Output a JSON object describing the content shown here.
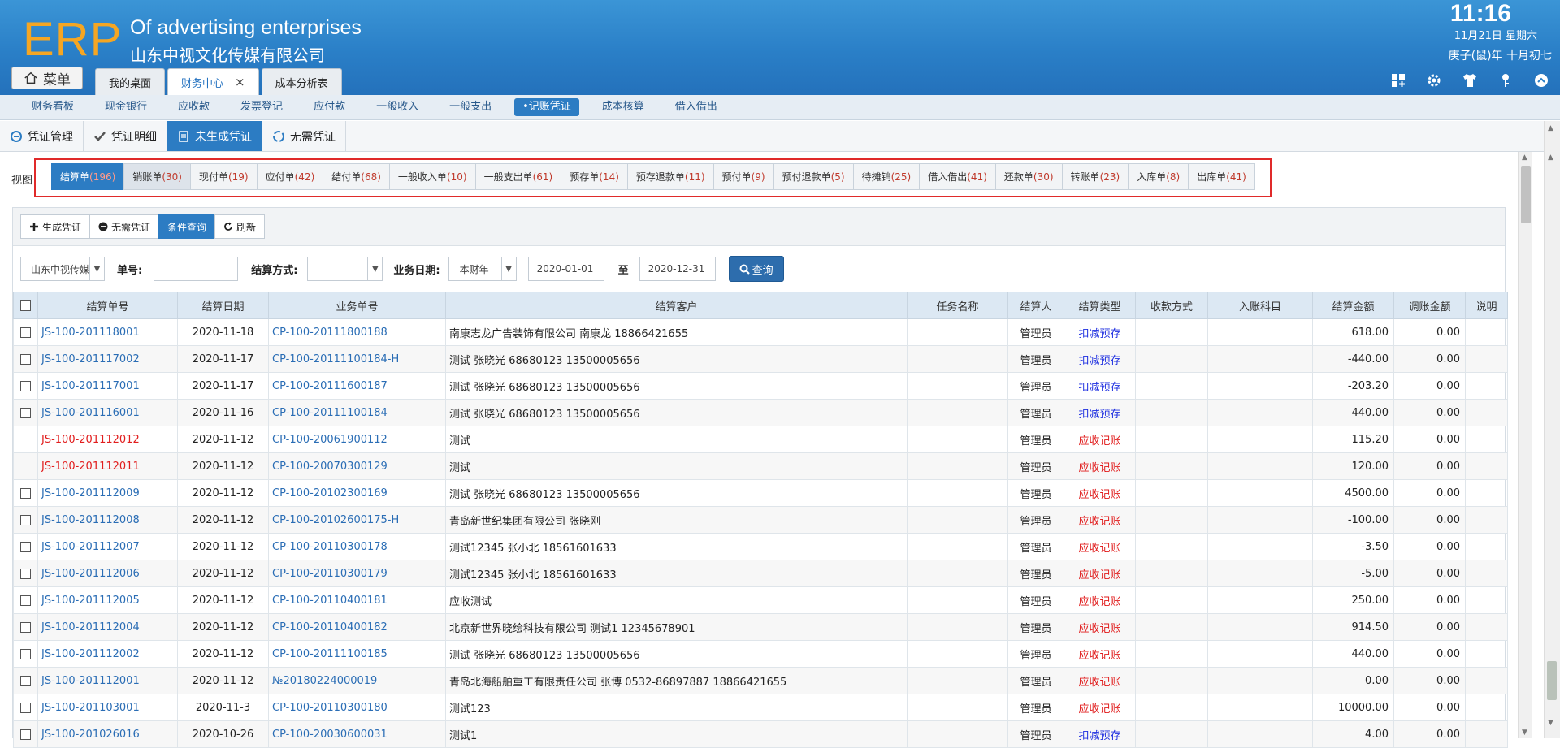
{
  "header": {
    "logo": "ERP",
    "enterprise_en": "Of advertising enterprises",
    "enterprise_cn": "山东中视文化传媒有限公司",
    "time": "11:16",
    "date": "11月21日 星期六",
    "lunar_date": "庚子(鼠)年 十月初七",
    "menu_label": "菜单",
    "tabs": [
      {
        "label": "我的桌面",
        "active": false
      },
      {
        "label": "财务中心",
        "active": true,
        "closable": true
      },
      {
        "label": "成本分析表",
        "active": false
      }
    ],
    "icons": [
      "grid-add-icon",
      "gear-icon",
      "shirt-icon",
      "key-icon",
      "chevron-up-circle-icon"
    ]
  },
  "modules": [
    "财务看板",
    "现金银行",
    "应收款",
    "发票登记",
    "应付款",
    "一般收入",
    "一般支出",
    "•记账凭证",
    "成本核算",
    "借入借出"
  ],
  "active_module": "•记账凭证",
  "sub_nav": [
    {
      "label": "凭证管理",
      "icon": "voucher-icon",
      "active": false
    },
    {
      "label": "凭证明细",
      "icon": "check-icon",
      "active": false
    },
    {
      "label": "未生成凭证",
      "icon": "document-icon",
      "active": true
    },
    {
      "label": "无需凭证",
      "icon": "recycle-icon",
      "active": false
    }
  ],
  "view_label": "视图",
  "view_tabs": [
    {
      "name": "结算单",
      "count": "(196)",
      "active": true
    },
    {
      "name": "销账单",
      "count": "(30)"
    },
    {
      "name": "现付单",
      "count": "(19)"
    },
    {
      "name": "应付单",
      "count": "(42)"
    },
    {
      "name": "结付单",
      "count": "(68)"
    },
    {
      "name": "一般收入单",
      "count": "(10)"
    },
    {
      "name": "一般支出单",
      "count": "(61)"
    },
    {
      "name": "预存单",
      "count": "(14)"
    },
    {
      "name": "预存退款单",
      "count": "(11)"
    },
    {
      "name": "预付单",
      "count": "(9)"
    },
    {
      "name": "预付退款单",
      "count": "(5)"
    },
    {
      "name": "待摊销",
      "count": "(25)"
    },
    {
      "name": "借入借出",
      "count": "(41)"
    },
    {
      "name": "还款单",
      "count": "(30)"
    },
    {
      "name": "转账单",
      "count": "(23)"
    },
    {
      "name": "入库单",
      "count": "(8)"
    },
    {
      "name": "出库单",
      "count": "(41)"
    }
  ],
  "toolbar": {
    "generate": "生成凭证",
    "no_need": "无需凭证",
    "condition_query": "条件查询",
    "refresh": "刷新"
  },
  "filter": {
    "company": "山东中视传媒",
    "doc_no_label": "单号:",
    "doc_no_value": "",
    "settle_method_label": "结算方式:",
    "settle_method_value": "",
    "biz_date_label": "业务日期:",
    "period": "本财年",
    "date_from": "2020-01-01",
    "to_label": "至",
    "date_to": "2020-12-31",
    "query": "查询"
  },
  "table": {
    "columns": [
      "结算单号",
      "结算日期",
      "业务单号",
      "结算客户",
      "任务名称",
      "结算人",
      "结算类型",
      "收款方式",
      "入账科目",
      "结算金额",
      "调账金额",
      "说明"
    ],
    "rows": [
      {
        "checkbox": true,
        "no": "JS-100-201118001",
        "red": false,
        "date": "2020-11-18",
        "biz": "CP-100-20111800188",
        "customer": "南康志龙广告装饰有限公司 南康龙 18866421655",
        "task": "",
        "person": "管理员",
        "type": "扣减预存",
        "type_color": "blue",
        "method": "",
        "subject": "",
        "amount": "618.00",
        "adjust": "0.00",
        "note": ""
      },
      {
        "checkbox": true,
        "no": "JS-100-201117002",
        "red": false,
        "date": "2020-11-17",
        "biz": "CP-100-20111100184-H",
        "customer": "测试 张晓光 68680123 13500005656",
        "task": "",
        "person": "管理员",
        "type": "扣减预存",
        "type_color": "blue",
        "method": "",
        "subject": "",
        "amount": "-440.00",
        "adjust": "0.00",
        "note": ""
      },
      {
        "checkbox": true,
        "no": "JS-100-201117001",
        "red": false,
        "date": "2020-11-17",
        "biz": "CP-100-20111600187",
        "customer": "测试 张晓光 68680123 13500005656",
        "task": "",
        "person": "管理员",
        "type": "扣减预存",
        "type_color": "blue",
        "method": "",
        "subject": "",
        "amount": "-203.20",
        "adjust": "0.00",
        "note": ""
      },
      {
        "checkbox": true,
        "no": "JS-100-201116001",
        "red": false,
        "date": "2020-11-16",
        "biz": "CP-100-20111100184",
        "customer": "测试 张晓光 68680123 13500005656",
        "task": "",
        "person": "管理员",
        "type": "扣减预存",
        "type_color": "blue",
        "method": "",
        "subject": "",
        "amount": "440.00",
        "adjust": "0.00",
        "note": ""
      },
      {
        "checkbox": false,
        "no": "JS-100-201112012",
        "red": true,
        "date": "2020-11-12",
        "biz": "CP-100-20061900112",
        "customer": "测试",
        "task": "",
        "person": "管理员",
        "type": "应收记账",
        "type_color": "red",
        "method": "",
        "subject": "",
        "amount": "115.20",
        "adjust": "0.00",
        "note": ""
      },
      {
        "checkbox": false,
        "no": "JS-100-201112011",
        "red": true,
        "date": "2020-11-12",
        "biz": "CP-100-20070300129",
        "customer": "测试",
        "task": "",
        "person": "管理员",
        "type": "应收记账",
        "type_color": "red",
        "method": "",
        "subject": "",
        "amount": "120.00",
        "adjust": "0.00",
        "note": ""
      },
      {
        "checkbox": true,
        "no": "JS-100-201112009",
        "red": false,
        "date": "2020-11-12",
        "biz": "CP-100-20102300169",
        "customer": "测试 张晓光 68680123 13500005656",
        "task": "",
        "person": "管理员",
        "type": "应收记账",
        "type_color": "red",
        "method": "",
        "subject": "",
        "amount": "4500.00",
        "adjust": "0.00",
        "note": ""
      },
      {
        "checkbox": true,
        "no": "JS-100-201112008",
        "red": false,
        "date": "2020-11-12",
        "biz": "CP-100-20102600175-H",
        "customer": "青岛新世纪集团有限公司 张晓刚",
        "task": "",
        "person": "管理员",
        "type": "应收记账",
        "type_color": "red",
        "method": "",
        "subject": "",
        "amount": "-100.00",
        "adjust": "0.00",
        "note": ""
      },
      {
        "checkbox": true,
        "no": "JS-100-201112007",
        "red": false,
        "date": "2020-11-12",
        "biz": "CP-100-20110300178",
        "customer": "测试12345 张小北 18561601633",
        "task": "",
        "person": "管理员",
        "type": "应收记账",
        "type_color": "red",
        "method": "",
        "subject": "",
        "amount": "-3.50",
        "adjust": "0.00",
        "note": ""
      },
      {
        "checkbox": true,
        "no": "JS-100-201112006",
        "red": false,
        "date": "2020-11-12",
        "biz": "CP-100-20110300179",
        "customer": "测试12345 张小北 18561601633",
        "task": "",
        "person": "管理员",
        "type": "应收记账",
        "type_color": "red",
        "method": "",
        "subject": "",
        "amount": "-5.00",
        "adjust": "0.00",
        "note": ""
      },
      {
        "checkbox": true,
        "no": "JS-100-201112005",
        "red": false,
        "date": "2020-11-12",
        "biz": "CP-100-20110400181",
        "customer": "应收测试",
        "task": "",
        "person": "管理员",
        "type": "应收记账",
        "type_color": "red",
        "method": "",
        "subject": "",
        "amount": "250.00",
        "adjust": "0.00",
        "note": ""
      },
      {
        "checkbox": true,
        "no": "JS-100-201112004",
        "red": false,
        "date": "2020-11-12",
        "biz": "CP-100-20110400182",
        "customer": "北京新世界晓绘科技有限公司 测试1 12345678901",
        "task": "",
        "person": "管理员",
        "type": "应收记账",
        "type_color": "red",
        "method": "",
        "subject": "",
        "amount": "914.50",
        "adjust": "0.00",
        "note": ""
      },
      {
        "checkbox": true,
        "no": "JS-100-201112002",
        "red": false,
        "date": "2020-11-12",
        "biz": "CP-100-20111100185",
        "customer": "测试 张晓光 68680123 13500005656",
        "task": "",
        "person": "管理员",
        "type": "应收记账",
        "type_color": "red",
        "method": "",
        "subject": "",
        "amount": "440.00",
        "adjust": "0.00",
        "note": ""
      },
      {
        "checkbox": true,
        "no": "JS-100-201112001",
        "red": false,
        "date": "2020-11-12",
        "biz": "№20180224000019",
        "customer": "青岛北海船舶重工有限责任公司 张博 0532-86897887 18866421655",
        "task": "",
        "person": "管理员",
        "type": "应收记账",
        "type_color": "red",
        "method": "",
        "subject": "",
        "amount": "0.00",
        "adjust": "0.00",
        "note": ""
      },
      {
        "checkbox": true,
        "no": "JS-100-201103001",
        "red": false,
        "date": "2020-11-3",
        "biz": "CP-100-20110300180",
        "customer": "测试123",
        "task": "",
        "person": "管理员",
        "type": "应收记账",
        "type_color": "red",
        "method": "",
        "subject": "",
        "amount": "10000.00",
        "adjust": "0.00",
        "note": ""
      },
      {
        "checkbox": true,
        "no": "JS-100-201026016",
        "red": false,
        "date": "2020-10-26",
        "biz": "CP-100-20030600031",
        "customer": "测试1",
        "task": "",
        "person": "管理员",
        "type": "扣减预存",
        "type_color": "blue",
        "method": "",
        "subject": "",
        "amount": "4.00",
        "adjust": "0.00",
        "note": ""
      }
    ]
  }
}
